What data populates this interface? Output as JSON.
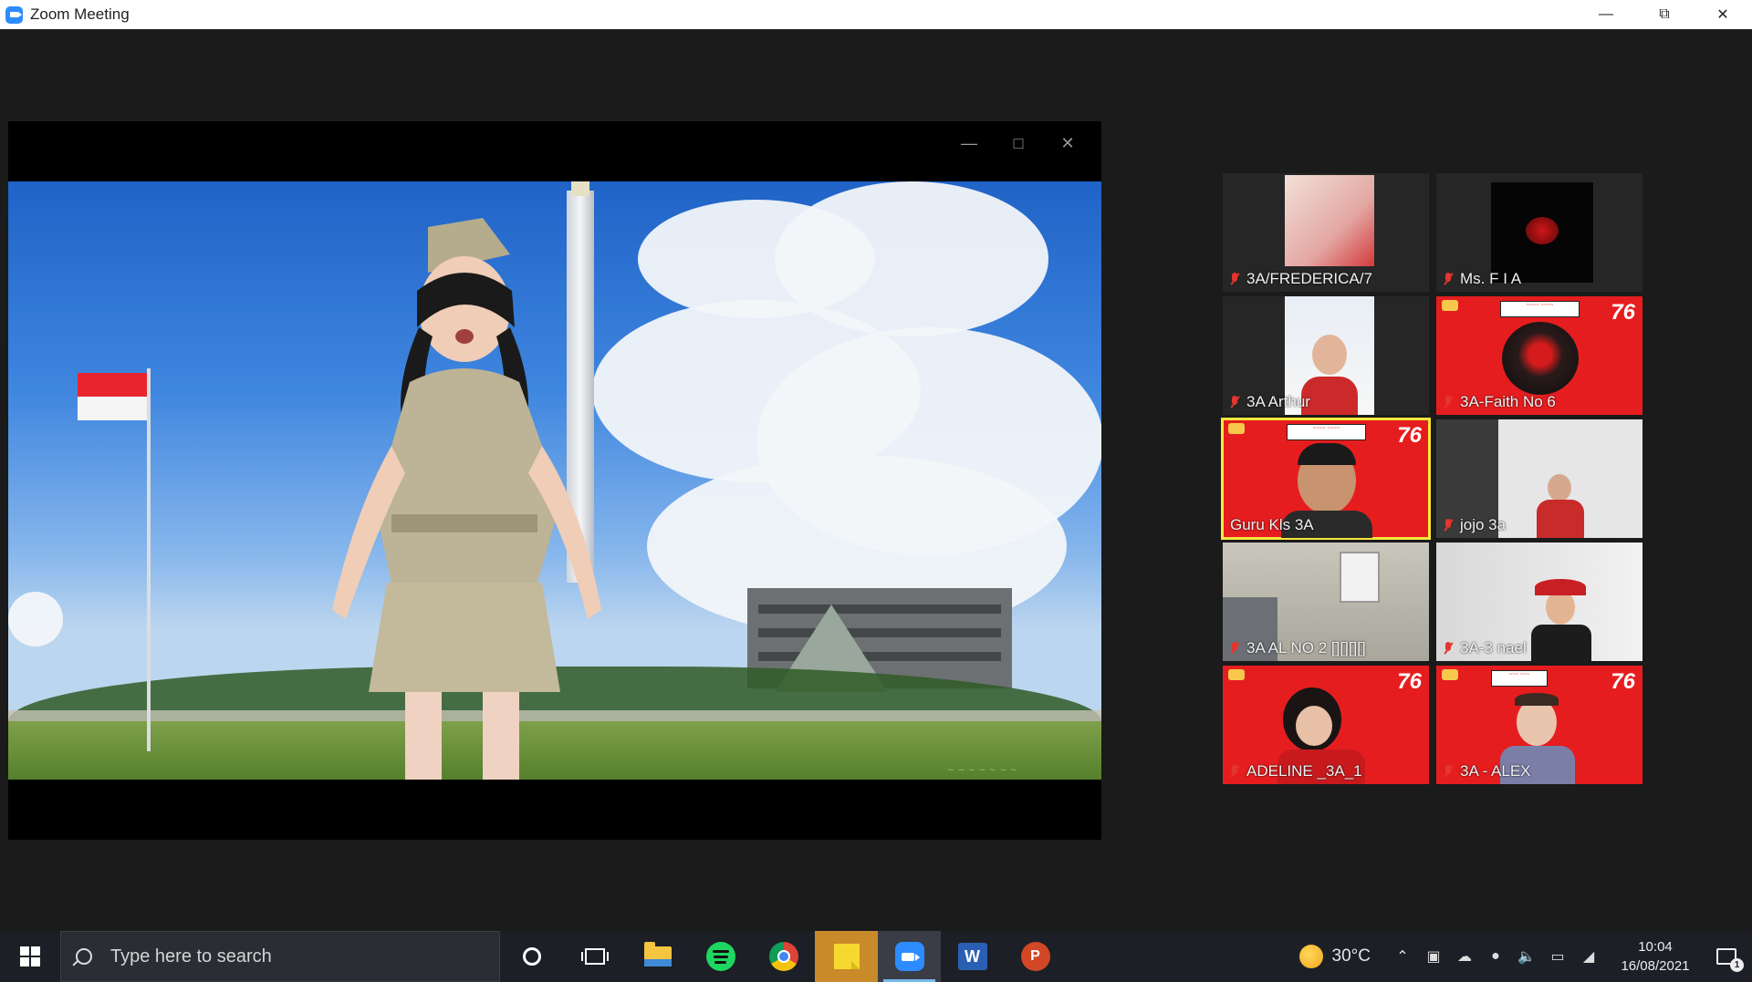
{
  "window": {
    "title": "Zoom Meeting",
    "controls": [
      "minimize",
      "restore",
      "close"
    ]
  },
  "shared_screen": {
    "controls": [
      "minimize",
      "maximize",
      "close"
    ],
    "flag_colors": {
      "top": "#e8252e",
      "bottom": "#f5f5f5"
    }
  },
  "gallery": {
    "active_speaker_color": "#f6e83c",
    "participants": [
      {
        "name": "3A/FREDERICA/7",
        "muted": true
      },
      {
        "name": "Ms. F I A",
        "muted": true
      },
      {
        "name": "3A Arthur",
        "muted": true
      },
      {
        "name": "3A-Faith No 6",
        "muted": true
      },
      {
        "name": "Guru Kls 3A",
        "muted": false,
        "active": true
      },
      {
        "name": "jojo 3a",
        "muted": true
      },
      {
        "name": "3A AL NO 2 [][][][]",
        "muted": true
      },
      {
        "name": "3A-3 nael",
        "muted": true
      },
      {
        "name": "ADELINE _3A_1",
        "muted": true
      },
      {
        "name": "3A - ALEX",
        "muted": true
      }
    ],
    "banner_number": "76"
  },
  "taskbar": {
    "search_placeholder": "Type here to search",
    "apps": [
      "cortana",
      "task-view",
      "file-explorer",
      "spotify",
      "chrome",
      "sticky-notes",
      "zoom",
      "word",
      "powerpoint"
    ],
    "active_app": "zoom",
    "word_letter": "W",
    "ppt_letter": "P"
  },
  "tray": {
    "temperature": "30°C",
    "time": "10:04",
    "date": "16/08/2021",
    "notification_count": "1"
  }
}
